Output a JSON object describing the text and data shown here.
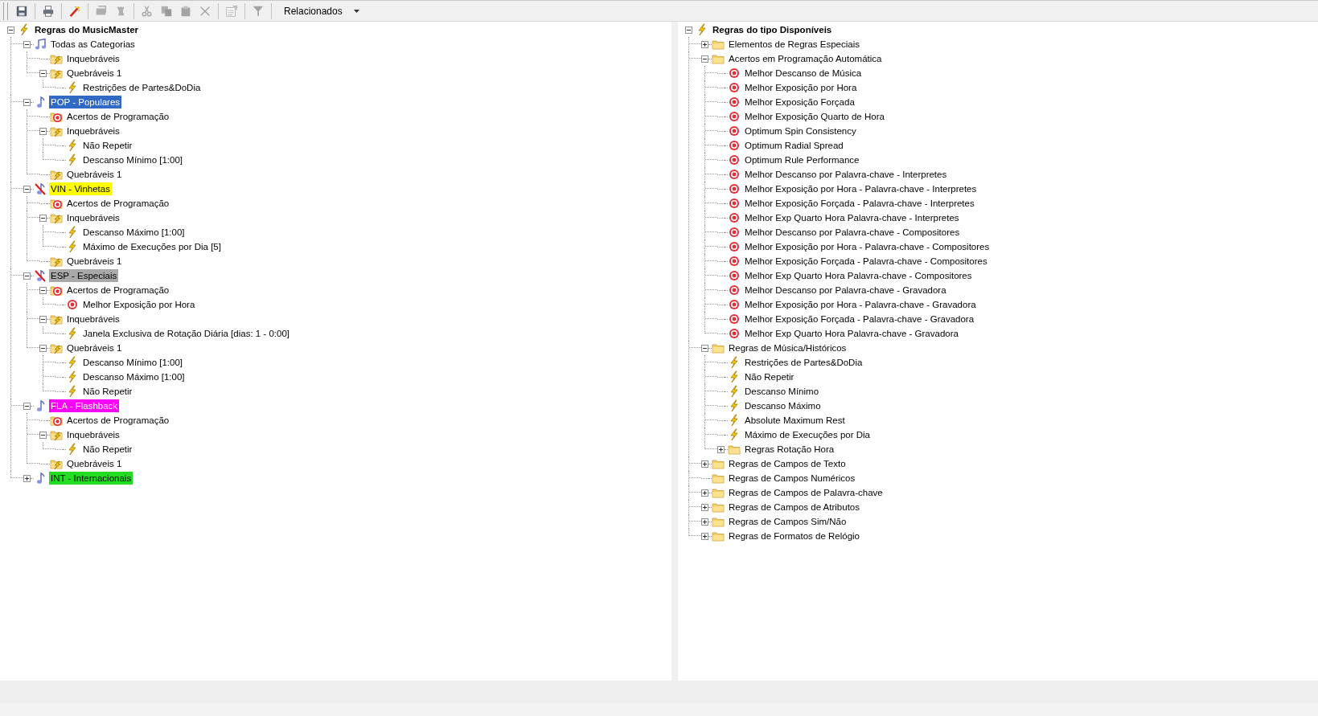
{
  "toolbar": {
    "items": [
      {
        "kind": "save",
        "disabled": false
      },
      {
        "kind": "separator"
      },
      {
        "kind": "print",
        "disabled": false
      },
      {
        "kind": "separator"
      },
      {
        "kind": "wand",
        "disabled": false
      },
      {
        "kind": "separator"
      },
      {
        "kind": "import",
        "disabled": true
      },
      {
        "kind": "export",
        "disabled": true
      },
      {
        "kind": "separator"
      },
      {
        "kind": "cut",
        "disabled": true
      },
      {
        "kind": "copy",
        "disabled": true
      },
      {
        "kind": "paste",
        "disabled": true
      },
      {
        "kind": "delete",
        "disabled": true
      },
      {
        "kind": "separator"
      },
      {
        "kind": "properties",
        "disabled": true
      },
      {
        "kind": "separator"
      },
      {
        "kind": "filter",
        "disabled": true
      },
      {
        "kind": "separator"
      },
      {
        "kind": "dropdown",
        "label": "Relacionados"
      }
    ]
  },
  "left_tree": {
    "label": "Regras do MusicMaster",
    "kind": "bolt",
    "expanded": true,
    "children": [
      {
        "label": "Todas as Categorias",
        "kind": "music",
        "expanded": true,
        "children": [
          {
            "label": "Inquebráveis",
            "kind": "folder-bolt"
          },
          {
            "label": "Quebráveis 1",
            "kind": "folder-bolt",
            "expanded": true,
            "children": [
              {
                "label": "Restrições de Partes&DoDia",
                "kind": "bolt"
              }
            ]
          }
        ]
      },
      {
        "label": "POP - Populares",
        "kind": "note",
        "color": "#3169c6",
        "expanded": true,
        "children": [
          {
            "label": "Acertos de Programação",
            "kind": "folder-target"
          },
          {
            "label": "Inquebráveis",
            "kind": "folder-bolt",
            "expanded": true,
            "children": [
              {
                "label": "Não Repetir",
                "kind": "bolt"
              },
              {
                "label": "Descanso Mínimo [1:00]",
                "kind": "bolt"
              }
            ]
          },
          {
            "label": "Quebráveis 1",
            "kind": "folder-bolt"
          }
        ]
      },
      {
        "label": "VIN - Vinhetas",
        "kind": "note-off",
        "color": "#ffff00",
        "expanded": true,
        "children": [
          {
            "label": "Acertos de Programação",
            "kind": "folder-target"
          },
          {
            "label": "Inquebráveis",
            "kind": "folder-bolt",
            "expanded": true,
            "children": [
              {
                "label": "Descanso Máximo [1:00]",
                "kind": "bolt"
              },
              {
                "label": "Máximo de Execuções por Dia [5]",
                "kind": "bolt"
              }
            ]
          },
          {
            "label": "Quebráveis 1",
            "kind": "folder-bolt"
          }
        ]
      },
      {
        "label": "ESP - Especiais",
        "kind": "note-off",
        "color": "#a9a9a9",
        "expanded": true,
        "children": [
          {
            "label": "Acertos de Programação",
            "kind": "folder-target",
            "expanded": true,
            "children": [
              {
                "label": "Melhor Exposição por Hora",
                "kind": "target"
              }
            ]
          },
          {
            "label": "Inquebráveis",
            "kind": "folder-bolt",
            "expanded": true,
            "children": [
              {
                "label": "Janela Exclusiva de Rotação Diária [dias: 1 - 0:00]",
                "kind": "bolt"
              }
            ]
          },
          {
            "label": "Quebráveis 1",
            "kind": "folder-bolt",
            "expanded": true,
            "children": [
              {
                "label": "Descanso Mínimo [1:00]",
                "kind": "bolt"
              },
              {
                "label": "Descanso Máximo [1:00]",
                "kind": "bolt"
              },
              {
                "label": "Não Repetir",
                "kind": "bolt"
              }
            ]
          }
        ]
      },
      {
        "label": "FLA - Flashback",
        "kind": "note",
        "color": "#ff00ff",
        "expanded": true,
        "children": [
          {
            "label": "Acertos de Programação",
            "kind": "folder-target"
          },
          {
            "label": "Inquebráveis",
            "kind": "folder-bolt",
            "expanded": true,
            "children": [
              {
                "label": "Não Repetir",
                "kind": "bolt"
              }
            ]
          },
          {
            "label": "Quebráveis 1",
            "kind": "folder-bolt"
          }
        ]
      },
      {
        "label": "INT - Internacionais",
        "kind": "note",
        "color": "#22dd22",
        "expanded": false
      }
    ]
  },
  "right_tree": {
    "label": "Regras do tipo Disponíveis",
    "kind": "bolt",
    "expanded": true,
    "children": [
      {
        "label": "Elementos de Regras Especiais",
        "kind": "folder",
        "expanded": false
      },
      {
        "label": "Acertos em Programação Automática",
        "kind": "folder",
        "expanded": true,
        "children": [
          {
            "label": "Melhor Descanso de Música",
            "kind": "target"
          },
          {
            "label": "Melhor Exposição por Hora",
            "kind": "target"
          },
          {
            "label": "Melhor Exposição Forçada",
            "kind": "target"
          },
          {
            "label": "Melhor Exposição Quarto de Hora",
            "kind": "target"
          },
          {
            "label": "Optimum Spin Consistency",
            "kind": "target"
          },
          {
            "label": "Optimum Radial Spread",
            "kind": "target"
          },
          {
            "label": "Optimum Rule Performance",
            "kind": "target"
          },
          {
            "label": "Melhor Descanso por Palavra-chave - Interpretes",
            "kind": "target"
          },
          {
            "label": "Melhor Exposição por Hora - Palavra-chave - Interpretes",
            "kind": "target"
          },
          {
            "label": "Melhor Exposição Forçada - Palavra-chave - Interpretes",
            "kind": "target"
          },
          {
            "label": "Melhor Exp Quarto Hora Palavra-chave - Interpretes",
            "kind": "target"
          },
          {
            "label": "Melhor Descanso por Palavra-chave - Compositores",
            "kind": "target"
          },
          {
            "label": "Melhor Exposição por Hora - Palavra-chave - Compositores",
            "kind": "target"
          },
          {
            "label": "Melhor Exposição Forçada - Palavra-chave - Compositores",
            "kind": "target"
          },
          {
            "label": "Melhor Exp Quarto Hora Palavra-chave - Compositores",
            "kind": "target"
          },
          {
            "label": "Melhor Descanso por Palavra-chave - Gravadora",
            "kind": "target"
          },
          {
            "label": "Melhor Exposição por Hora - Palavra-chave - Gravadora",
            "kind": "target"
          },
          {
            "label": "Melhor Exposição Forçada - Palavra-chave - Gravadora",
            "kind": "target"
          },
          {
            "label": "Melhor Exp Quarto Hora Palavra-chave - Gravadora",
            "kind": "target"
          }
        ]
      },
      {
        "label": "Regras de Música/Históricos",
        "kind": "folder",
        "expanded": true,
        "children": [
          {
            "label": "Restrições de Partes&DoDia",
            "kind": "bolt"
          },
          {
            "label": "Não Repetir",
            "kind": "bolt"
          },
          {
            "label": "Descanso Mínimo",
            "kind": "bolt"
          },
          {
            "label": "Descanso Máximo",
            "kind": "bolt"
          },
          {
            "label": "Absolute Maximum Rest",
            "kind": "bolt"
          },
          {
            "label": "Máximo de Execuções por Dia",
            "kind": "bolt"
          },
          {
            "label": "Regras Rotação Hora",
            "kind": "folder",
            "expanded": false
          }
        ]
      },
      {
        "label": "Regras de Campos de Texto",
        "kind": "folder",
        "expanded": false
      },
      {
        "label": "Regras de Campos Numéricos",
        "kind": "folder"
      },
      {
        "label": "Regras de Campos de Palavra-chave",
        "kind": "folder",
        "expanded": false
      },
      {
        "label": "Regras de Campos de Atributos",
        "kind": "folder",
        "expanded": false
      },
      {
        "label": "Regras de Campos Sim/Não",
        "kind": "folder",
        "expanded": false
      },
      {
        "label": "Regras de Formatos de Relógio",
        "kind": "folder",
        "expanded": false
      }
    ]
  }
}
